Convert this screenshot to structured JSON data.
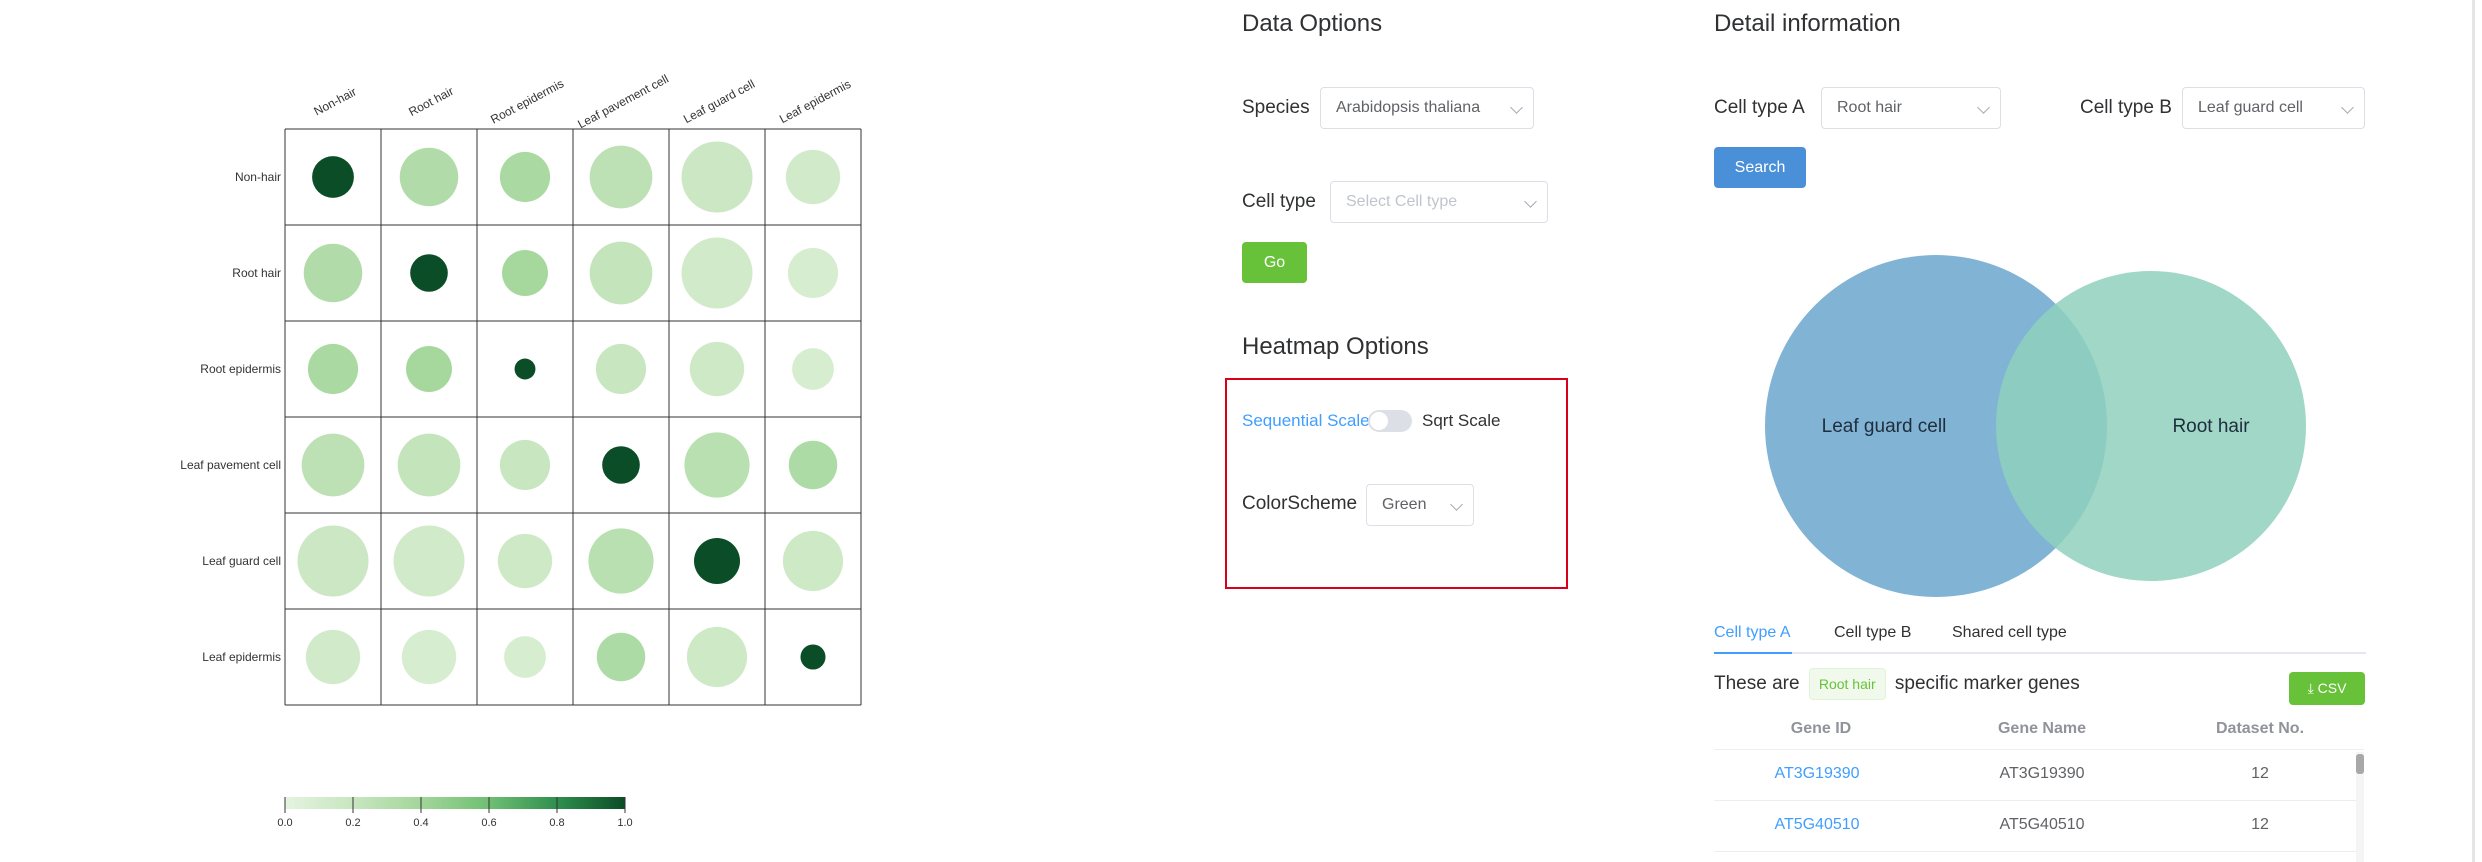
{
  "heatmap": {
    "labels": [
      "Non-hair",
      "Root hair",
      "Root epidermis",
      "Leaf pavement cell",
      "Leaf guard cell",
      "Leaf epidermis"
    ],
    "values": [
      [
        1.0,
        0.32,
        0.36,
        0.26,
        0.18,
        0.14
      ],
      [
        0.32,
        1.0,
        0.38,
        0.22,
        0.14,
        0.1
      ],
      [
        0.36,
        0.38,
        1.0,
        0.2,
        0.16,
        0.1
      ],
      [
        0.26,
        0.22,
        0.2,
        1.0,
        0.28,
        0.34
      ],
      [
        0.18,
        0.14,
        0.16,
        0.28,
        1.0,
        0.16
      ],
      [
        0.14,
        0.1,
        0.1,
        0.34,
        0.16,
        1.0
      ]
    ],
    "size": [
      [
        0.5,
        0.7,
        0.6,
        0.75,
        0.85,
        0.65
      ],
      [
        0.7,
        0.45,
        0.55,
        0.75,
        0.85,
        0.6
      ],
      [
        0.6,
        0.55,
        0.25,
        0.6,
        0.65,
        0.5
      ],
      [
        0.75,
        0.75,
        0.6,
        0.45,
        0.78,
        0.58
      ],
      [
        0.85,
        0.85,
        0.65,
        0.78,
        0.55,
        0.72
      ],
      [
        0.65,
        0.65,
        0.5,
        0.58,
        0.72,
        0.3
      ]
    ],
    "legend": {
      "ticks": [
        "0.0",
        "0.2",
        "0.4",
        "0.6",
        "0.8",
        "1.0"
      ],
      "colors": [
        "#e5f3e0",
        "#c8e6c0",
        "#a2d69a",
        "#6fbf73",
        "#2f8f4e",
        "#0b4d26"
      ]
    }
  },
  "data_options": {
    "title": "Data Options",
    "species_label": "Species",
    "species_value": "Arabidopsis thaliana",
    "celltype_label": "Cell type",
    "celltype_placeholder": "Select Cell type",
    "go_label": "Go"
  },
  "heatmap_options": {
    "title": "Heatmap Options",
    "scale_left": "Sequential Scale",
    "scale_right": "Sqrt Scale",
    "colorscheme_label": "ColorScheme",
    "colorscheme_value": "Green"
  },
  "detail": {
    "title": "Detail information",
    "celltype_a_label": "Cell type A",
    "celltype_a_value": "Root hair",
    "celltype_b_label": "Cell type B",
    "celltype_b_value": "Leaf guard cell",
    "search_label": "Search",
    "venn": {
      "left_label": "Leaf guard cell",
      "right_label": "Root hair",
      "colors": {
        "left": "#6fa8cf",
        "right": "#8fd0bc",
        "overlap": "#5aa5b4"
      }
    },
    "tabs": [
      "Cell type A",
      "Cell type B",
      "Shared cell type"
    ],
    "sentence_prefix": "These are",
    "sentence_tag": "Root hair",
    "sentence_suffix": "specific marker genes",
    "csv_label": "⤓ CSV",
    "table": {
      "headers": [
        "Gene ID",
        "Gene Name",
        "Dataset No."
      ],
      "rows": [
        [
          "AT3G19390",
          "AT3G19390",
          "12"
        ],
        [
          "AT5G40510",
          "AT5G40510",
          "12"
        ]
      ]
    }
  }
}
